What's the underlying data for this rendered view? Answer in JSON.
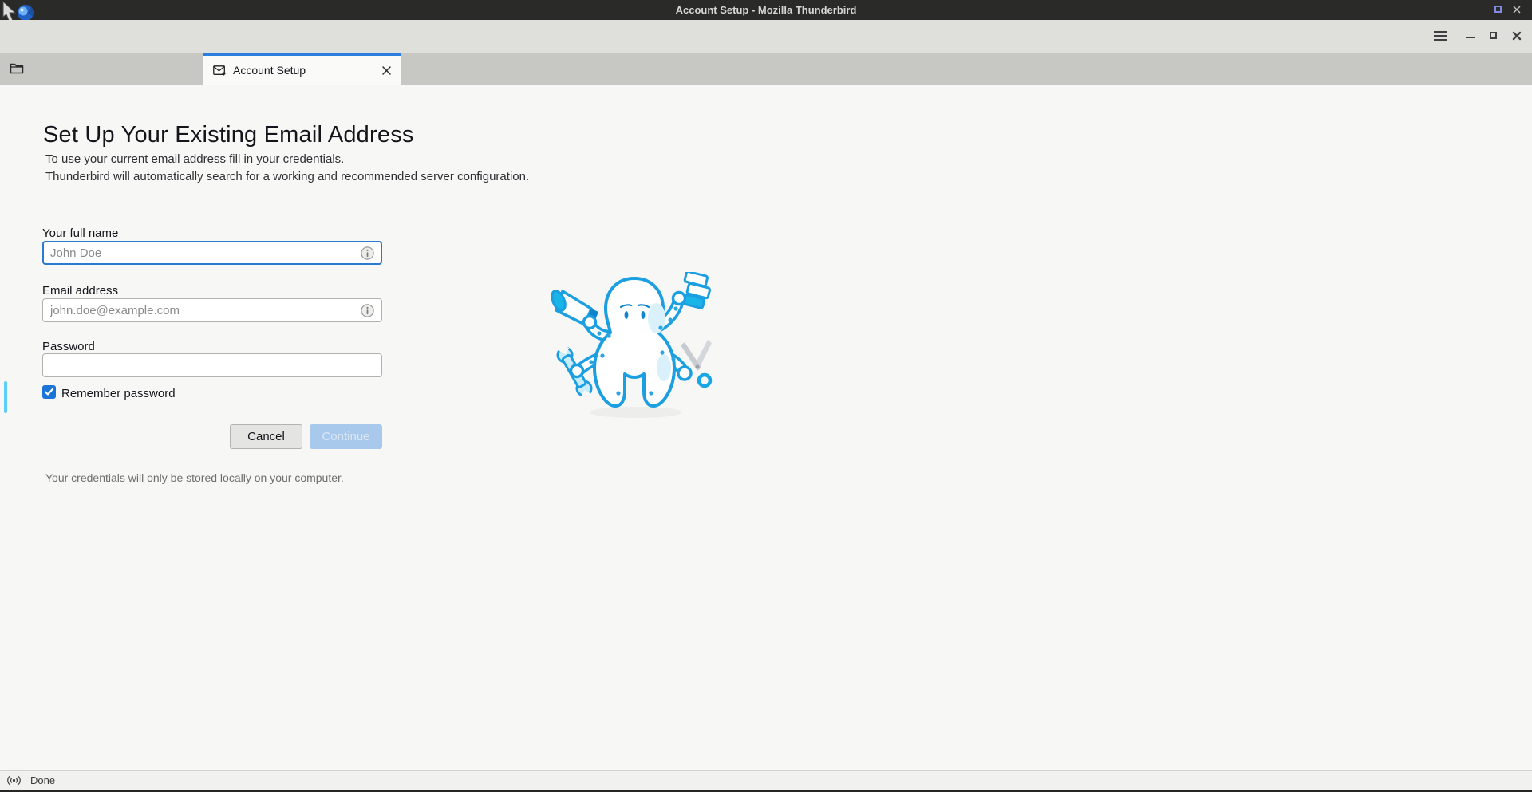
{
  "titlebar": {
    "title": "Account Setup - Mozilla Thunderbird",
    "icons": [
      "thunderbird-logo",
      "restore",
      "close"
    ]
  },
  "toolbar": {
    "icons": [
      "menu",
      "minimize",
      "maximize",
      "close"
    ]
  },
  "tabbar": {
    "icons": [
      "spaces-folder"
    ],
    "active_tab": {
      "label": "Account Setup",
      "icon": "account-setup-envelope"
    }
  },
  "main": {
    "heading": "Set Up Your Existing Email Address",
    "subtitle_line1": "To use your current email address fill in your credentials.",
    "subtitle_line2": "Thunderbird will automatically search for a working and recommended server configuration.",
    "form": {
      "fullname": {
        "label": "Your full name",
        "placeholder": "John Doe",
        "value": "",
        "focused": true,
        "info_icon": "info"
      },
      "email": {
        "label": "Email address",
        "placeholder": "john.doe@example.com",
        "value": "",
        "info_icon": "info"
      },
      "password": {
        "label": "Password",
        "value": ""
      },
      "remember": {
        "label": "Remember password",
        "checked": true
      },
      "cancel_label": "Cancel",
      "continue_label": "Continue",
      "continue_enabled": false
    },
    "privacy_note": "Your credentials will only be stored locally on your computer.",
    "illustration": "thunderbird-octopus-mascot"
  },
  "statusbar": {
    "text": "Done",
    "icon": "broadcast"
  },
  "colors": {
    "titlebar_bg": "#2a2a29",
    "toolbar_bg": "#dfdfdb",
    "tabbar_bg": "#c7c7c3",
    "content_bg": "#f7f7f6",
    "tab_stripe_blue": "#2b7de0",
    "focus_ring_blue": "#2a7ad2",
    "checkbox_blue": "#1b74d8",
    "disabled_button_bg": "#a9c9ec",
    "highlight_strip_cyan": "#5bd0f4",
    "mascot_outline_blue": "#1b9fe0"
  }
}
